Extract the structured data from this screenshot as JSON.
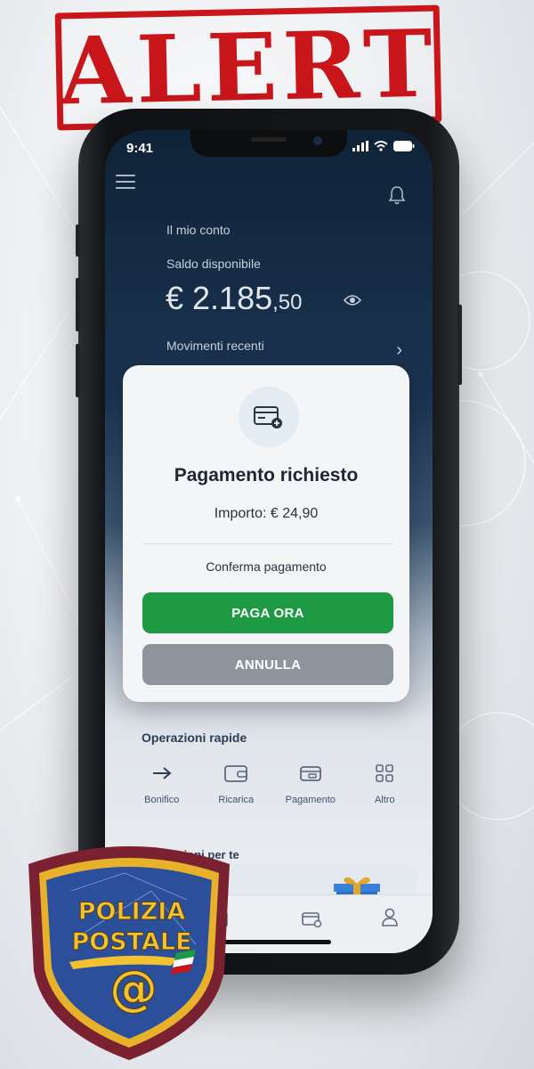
{
  "stamp": {
    "text": "ALERT",
    "color": "#c8161b"
  },
  "status_bar": {
    "time": "9:41"
  },
  "account": {
    "title": "Il mio conto",
    "balance_label": "Saldo disponibile",
    "balance_main": "€ 2.185",
    "balance_cents": ",50",
    "recent_label": "Movimenti recenti"
  },
  "modal": {
    "icon": "card-add-icon",
    "title": "Pagamento richiesto",
    "amount": "Importo: € 24,90",
    "confirm_text": "Conferma pagamento",
    "pay_button": "PAGA ORA",
    "cancel_button": "ANNULLA",
    "pay_color": "#1f9a44",
    "cancel_color": "#8e949b"
  },
  "quick_ops": {
    "title": "Operazioni rapide",
    "items": [
      {
        "label": "Bonifico",
        "icon": "arrow-right-icon"
      },
      {
        "label": "Ricarica",
        "icon": "wallet-icon"
      },
      {
        "label": "Pagamento",
        "icon": "payment-icon"
      },
      {
        "label": "Altro",
        "icon": "grid-icon"
      }
    ]
  },
  "promotions": {
    "title": "Promozioni per te",
    "icon": "gift-icon"
  },
  "tabbar": {
    "icons": [
      "home-icon",
      "card-icon",
      "user-icon"
    ]
  },
  "badge": {
    "line1": "POLIZIA",
    "line2": "POSTALE",
    "symbol": "@"
  }
}
